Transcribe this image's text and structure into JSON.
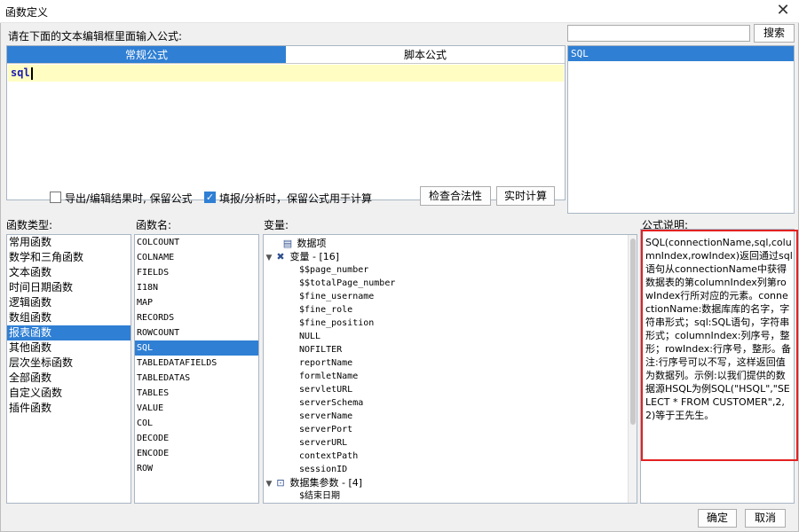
{
  "window": {
    "title": "函数定义",
    "close_glyph": "✕"
  },
  "prompt_label": "请在下面的文本编辑框里面输入公式:",
  "tabs": [
    {
      "label": "常规公式",
      "active": true
    },
    {
      "label": "脚本公式",
      "active": false
    }
  ],
  "editor": {
    "text": "sql"
  },
  "search": {
    "value": "",
    "button": "搜索",
    "results": [
      "SQL"
    ]
  },
  "options": {
    "export_keep": {
      "label": "导出/编辑结果时, 保留公式",
      "checked": false
    },
    "fill_keep": {
      "label": "填报/分析时，保留公式用于计算",
      "checked": true
    },
    "check_button": "检查合法性",
    "realtime_button": "实时计算"
  },
  "headers": {
    "func_type": "函数类型:",
    "func_name": "函数名:",
    "variables": "变量:",
    "description": "公式说明:"
  },
  "func_types": [
    "常用函数",
    "数学和三角函数",
    "文本函数",
    "时间日期函数",
    "逻辑函数",
    "数组函数",
    "报表函数",
    "其他函数",
    "层次坐标函数",
    "全部函数",
    "自定义函数",
    "插件函数"
  ],
  "func_types_selected": 6,
  "func_names": [
    "COLCOUNT",
    "COLNAME",
    "FIELDS",
    "I18N",
    "MAP",
    "RECORDS",
    "ROWCOUNT",
    "SQL",
    "TABLEDATAFIELDS",
    "TABLEDATAS",
    "TABLES",
    "VALUE",
    "COL",
    "DECODE",
    "ENCODE",
    "ROW"
  ],
  "func_names_selected": 7,
  "variables": {
    "data_item": "数据项",
    "var_group": "变量 - [16]",
    "vars": [
      "$$page_number",
      "$$totalPage_number",
      "$fine_username",
      "$fine_role",
      "$fine_position",
      "NULL",
      "NOFILTER",
      "reportName",
      "formletName",
      "servletURL",
      "serverSchema",
      "serverName",
      "serverPort",
      "serverURL",
      "contextPath",
      "sessionID"
    ],
    "dataset_group": "数据集参数 - [4]",
    "dataset_first": "$结束日期"
  },
  "description": "SQL(connectionName,sql,columnIndex,rowIndex)返回通过sql语句从connectionName中获得数据表的第columnIndex列第rowIndex行所对应的元素。connectionName:数据库库的名字，字符串形式；sql:SQL语句，字符串形式；columnIndex:列序号，整形；rowIndex:行序号，整形。备注:行序号可以不写，这样返回值为数据列。示例:以我们提供的数据源HSQL为例SQL(\"HSQL\",\"SELECT * FROM CUSTOMER\",2,2)等于王先生。",
  "footer": {
    "ok": "确定",
    "cancel": "取消"
  },
  "colors": {
    "accent": "#2f7fd4",
    "editor_bg": "#fffdc2",
    "highlight_border": "#e32121"
  }
}
